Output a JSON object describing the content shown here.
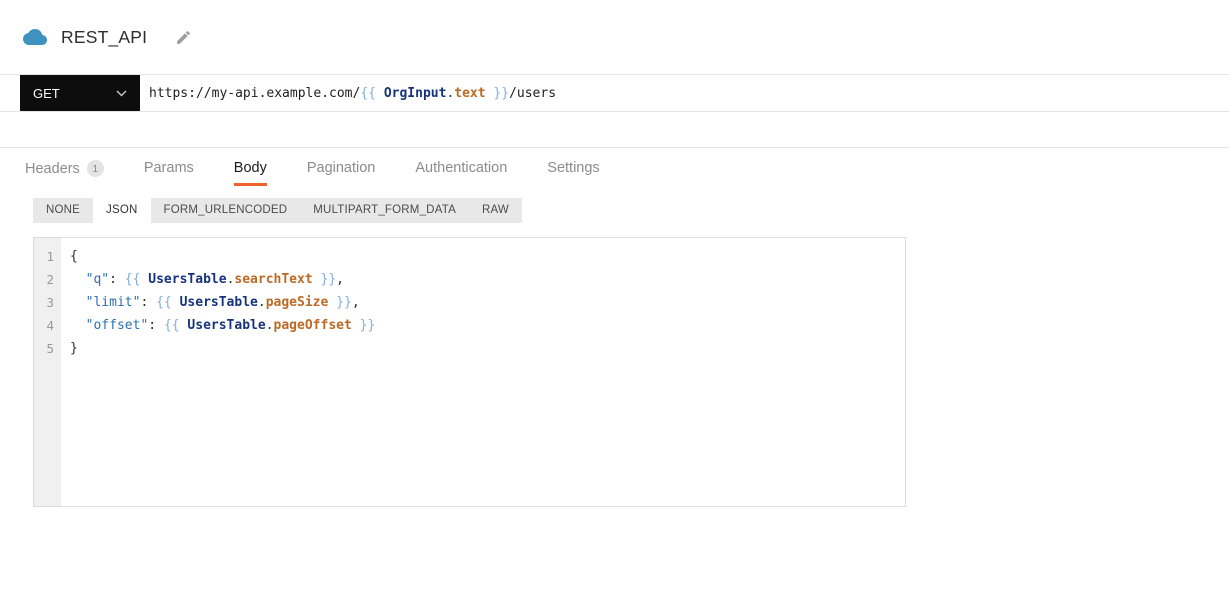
{
  "header": {
    "title": "REST_API",
    "icons": {
      "app_icon": "cloud-icon",
      "rename_icon": "pencil-icon"
    }
  },
  "request": {
    "method": "GET",
    "url_tokens": [
      {
        "t": "https://my-api.example.com/",
        "c": "plain"
      },
      {
        "t": "{{ ",
        "c": "brace"
      },
      {
        "t": "OrgInput",
        "c": "entity"
      },
      {
        "t": ".",
        "c": "punct"
      },
      {
        "t": "text",
        "c": "prop"
      },
      {
        "t": " }}",
        "c": "brace"
      },
      {
        "t": "/users",
        "c": "plain"
      }
    ]
  },
  "tabs": {
    "items": [
      {
        "label": "Headers",
        "badge": "1",
        "active": false
      },
      {
        "label": "Params",
        "active": false
      },
      {
        "label": "Body",
        "active": true
      },
      {
        "label": "Pagination",
        "active": false
      },
      {
        "label": "Authentication",
        "active": false
      },
      {
        "label": "Settings",
        "active": false
      }
    ]
  },
  "body_type_tabs": {
    "items": [
      {
        "label": "NONE",
        "active": false
      },
      {
        "label": "JSON",
        "active": true
      },
      {
        "label": "FORM_URLENCODED",
        "active": false
      },
      {
        "label": "MULTIPART_FORM_DATA",
        "active": false
      },
      {
        "label": "RAW",
        "active": false
      }
    ]
  },
  "editor": {
    "lines": [
      {
        "num": "1",
        "tokens": [
          {
            "t": "{",
            "c": "punct"
          }
        ]
      },
      {
        "num": "2",
        "tokens": [
          {
            "t": "  ",
            "c": "plain"
          },
          {
            "t": "\"q\"",
            "c": "key"
          },
          {
            "t": ": ",
            "c": "punct"
          },
          {
            "t": "{{ ",
            "c": "brace"
          },
          {
            "t": "UsersTable",
            "c": "entity"
          },
          {
            "t": ".",
            "c": "punct"
          },
          {
            "t": "searchText",
            "c": "prop"
          },
          {
            "t": " }}",
            "c": "brace"
          },
          {
            "t": ",",
            "c": "punct"
          }
        ]
      },
      {
        "num": "3",
        "tokens": [
          {
            "t": "  ",
            "c": "plain"
          },
          {
            "t": "\"limit\"",
            "c": "key"
          },
          {
            "t": ": ",
            "c": "punct"
          },
          {
            "t": "{{ ",
            "c": "brace"
          },
          {
            "t": "UsersTable",
            "c": "entity"
          },
          {
            "t": ".",
            "c": "punct"
          },
          {
            "t": "pageSize",
            "c": "prop"
          },
          {
            "t": " }}",
            "c": "brace"
          },
          {
            "t": ",",
            "c": "punct"
          }
        ]
      },
      {
        "num": "4",
        "tokens": [
          {
            "t": "  ",
            "c": "plain"
          },
          {
            "t": "\"offset\"",
            "c": "key"
          },
          {
            "t": ": ",
            "c": "punct"
          },
          {
            "t": "{{ ",
            "c": "brace"
          },
          {
            "t": "UsersTable",
            "c": "entity"
          },
          {
            "t": ".",
            "c": "punct"
          },
          {
            "t": "pageOffset",
            "c": "prop"
          },
          {
            "t": " }}",
            "c": "brace"
          }
        ]
      },
      {
        "num": "5",
        "tokens": [
          {
            "t": "}",
            "c": "punct"
          }
        ]
      }
    ]
  },
  "colors": {
    "accent_orange": "#f0622b",
    "method_dropdown_bg": "#0d0d0d",
    "app_icon_blue": "#3d92c0",
    "binding_brace": "#85aedd",
    "binding_entity": "#17337d",
    "binding_property": "#bc6a25",
    "json_key": "#2d6fb4",
    "subtab_strip_bg": "#e8e8e8",
    "editor_gutter_bg": "#f0f0f0"
  }
}
